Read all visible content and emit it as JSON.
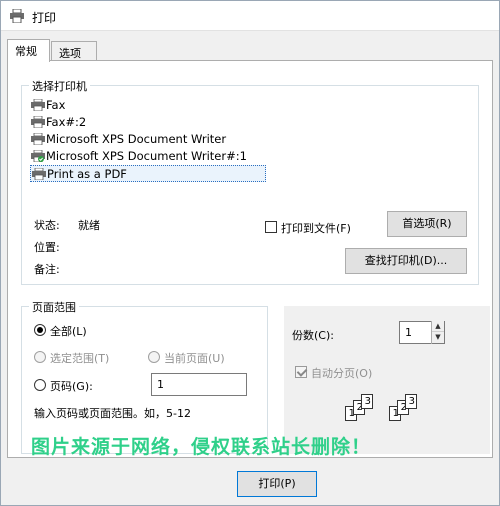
{
  "window": {
    "title": "打印"
  },
  "tabs": [
    {
      "label": "常规",
      "active": true
    },
    {
      "label": "选项",
      "active": false
    }
  ],
  "printer_group": {
    "label": "选择打印机",
    "printers": [
      {
        "name": "Fax",
        "icon": "printer-icon",
        "selected": false
      },
      {
        "name": "Fax#:2",
        "icon": "printer-icon",
        "selected": false
      },
      {
        "name": "Microsoft XPS Document Writer",
        "icon": "printer-icon",
        "selected": false
      },
      {
        "name": "Microsoft XPS Document Writer#:1",
        "icon": "default-printer-icon",
        "selected": false
      },
      {
        "name": "Print as a PDF",
        "icon": "printer-icon",
        "selected": true
      }
    ],
    "status_label": "状态:",
    "status_value": "就绪",
    "location_label": "位置:",
    "comment_label": "备注:",
    "print_to_file_label": "打印到文件(F)",
    "preferences_button": "首选项(R)",
    "find_printer_button": "查找打印机(D)..."
  },
  "page_range": {
    "label": "页面范围",
    "all_label": "全部(L)",
    "selection_label": "选定范围(T)",
    "current_page_label": "当前页面(U)",
    "pages_label": "页码(G):",
    "pages_value": "1",
    "hint": "输入页码或页面范围。如，5-12"
  },
  "copies": {
    "label": "份数(C):",
    "value": "1",
    "collate_label": "自动分页(O)",
    "collate_checked": true
  },
  "watermark": "图片来源于网络，侵权联系站长删除！",
  "footer": {
    "print_button": "打印(P)"
  },
  "colors": {
    "accent": "#0078d7",
    "watermark": "#2fd08a"
  }
}
